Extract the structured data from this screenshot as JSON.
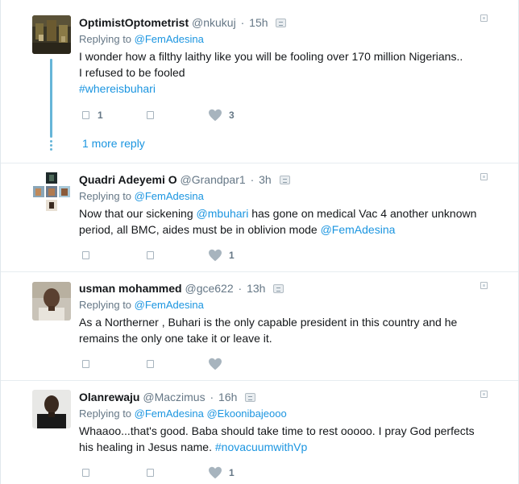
{
  "tweets": [
    {
      "fullname": "OptimistOptometrist",
      "username": "@nkukuj",
      "time": "15h",
      "replying_label": "Replying to",
      "replying_to": "@FemAdesina",
      "text_line1": "I wonder how a filthy laithy like you will  be fooling over 170 million Nigerians..",
      "text_line2": "I refused to be fooled",
      "hashtag": "#whereisbuhari",
      "reply_count": "1",
      "retweet_count": "",
      "like_count": "3",
      "more_replies": "1 more reply"
    },
    {
      "fullname": "Quadri Adeyemi O",
      "username": "@Grandpar1",
      "time": "3h",
      "replying_label": "Replying to",
      "replying_to": "@FemAdesina",
      "text_part1": "Now that our sickening ",
      "mention1": "@mbuhari",
      "text_part2": " has gone on medical Vac 4 another unknown",
      "text_part3": "period, all BMC, aides must be in oblivion mode ",
      "mention2": "@FemAdesina",
      "reply_count": "",
      "retweet_count": "",
      "like_count": "1"
    },
    {
      "fullname": "usman mohammed",
      "username": "@gce622",
      "time": "13h",
      "replying_label": "Replying to",
      "replying_to": "@FemAdesina",
      "text_line1": "As a Northerner , Buhari is the only capable president in this country and he",
      "text_line2": "remains the only one take it or leave it.",
      "reply_count": "",
      "retweet_count": "",
      "like_count": ""
    },
    {
      "fullname": "Olanrewaju",
      "username": "@Maczimus",
      "time": "16h",
      "replying_label": "Replying to",
      "replying_to": "@FemAdesina",
      "replying_to2": "@Ekoonibajeooo",
      "text_line1": "Whaaoo...that's good. Baba should take time to rest ooooo. I pray God perfects",
      "text_line2": "his healing in Jesus name. ",
      "hashtag": "#novacuumwithVp",
      "reply_count": "",
      "retweet_count": "",
      "like_count": "1"
    }
  ],
  "icons": {
    "reply": "reply-icon",
    "retweet": "retweet-icon",
    "like": "heart-icon",
    "caret": "caret-icon",
    "translate": "translate-icon"
  },
  "colors": {
    "link": "#1b95e0",
    "muted": "#657786",
    "thread": "#66b5d8",
    "border": "#e6ecf0"
  }
}
